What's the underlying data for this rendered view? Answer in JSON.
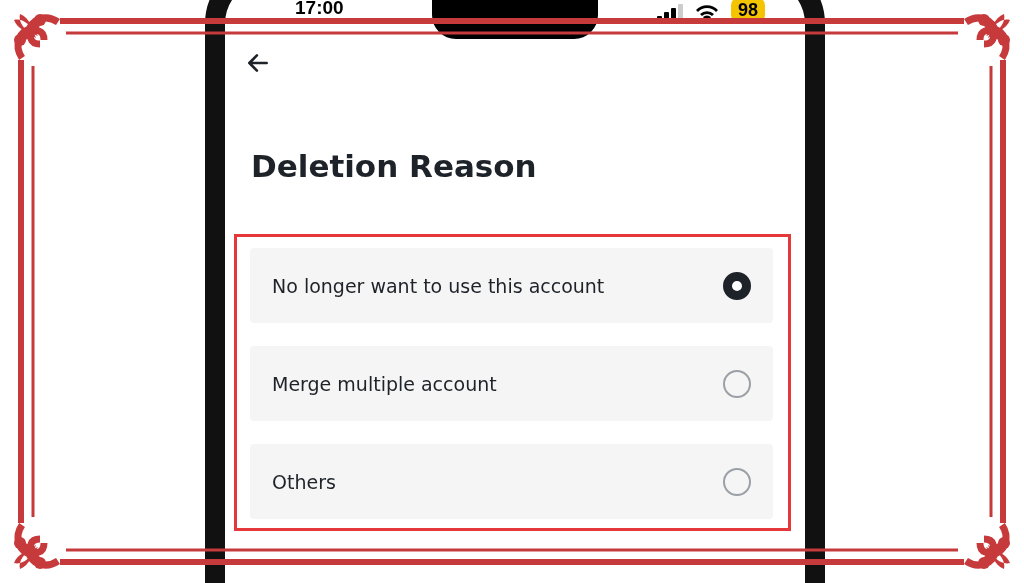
{
  "status_bar": {
    "time": "17:00",
    "battery": "98"
  },
  "title": "Deletion Reason",
  "reasons": [
    {
      "label": "No longer want to use this account",
      "selected": true
    },
    {
      "label": "Merge multiple account",
      "selected": false
    },
    {
      "label": "Others",
      "selected": false
    }
  ]
}
